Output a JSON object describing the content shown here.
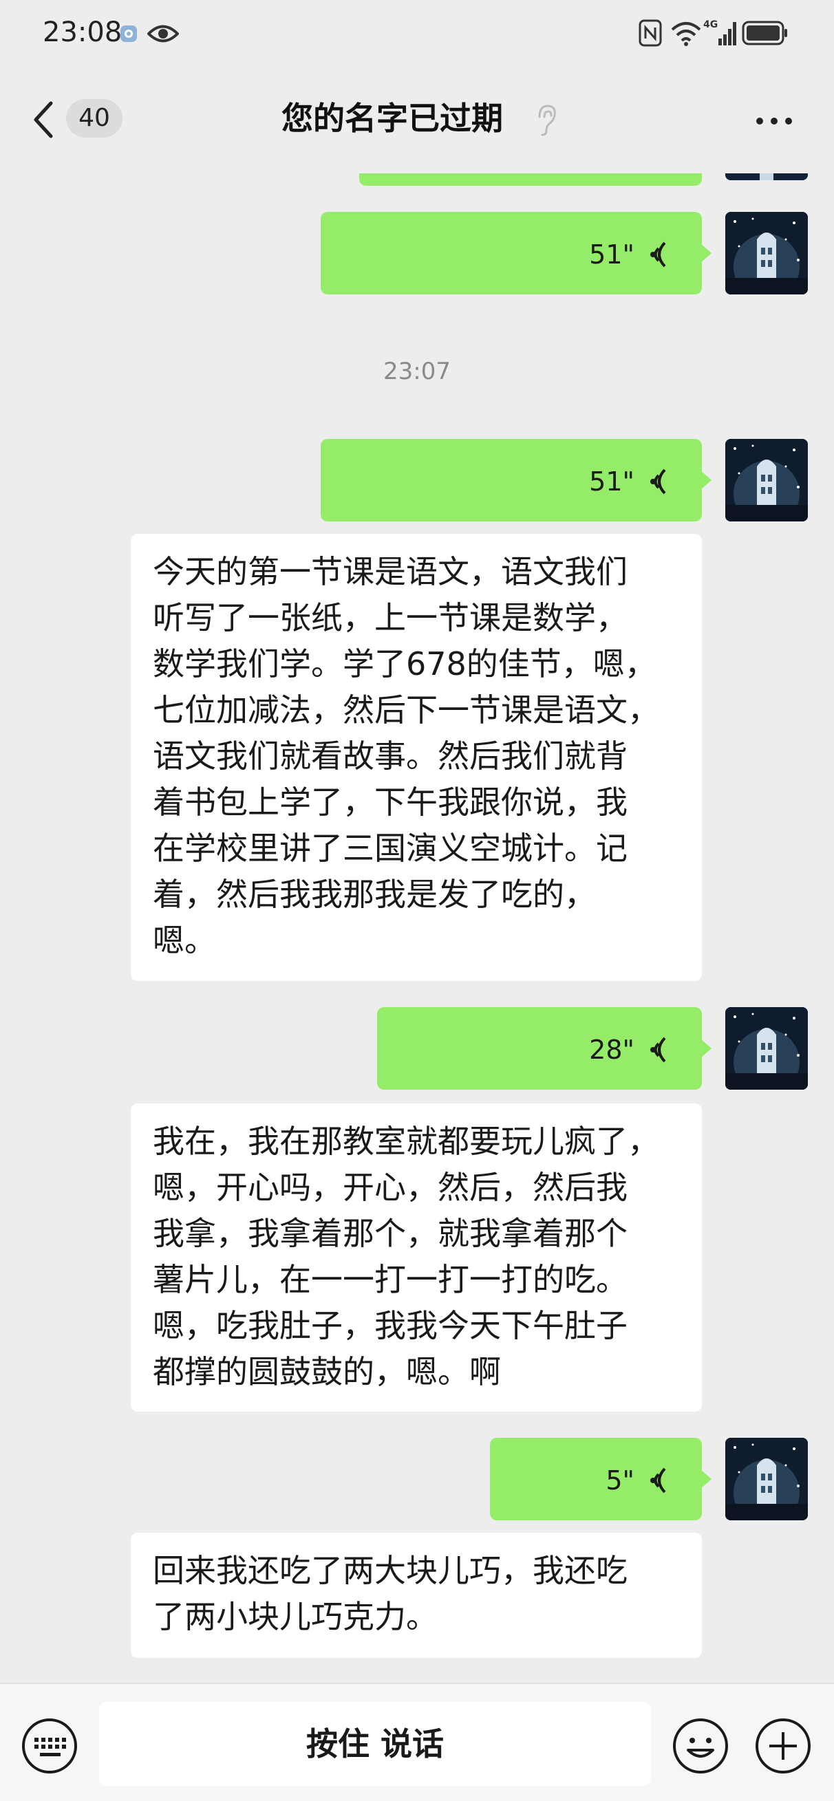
{
  "status_bar": {
    "time": "23:08",
    "network": "4G"
  },
  "header": {
    "unread_count": "40",
    "title": "您的名字已过期"
  },
  "messages": [
    {
      "type": "voice",
      "duration": "51\""
    },
    {
      "type": "timestamp",
      "text": "23:07"
    },
    {
      "type": "voice",
      "duration": "51\""
    },
    {
      "type": "transcript",
      "text": "今天的第一节课是语文，语文我们\n听写了一张纸，上一节课是数学，\n数学我们学。学了678的佳节，嗯，\n七位加减法，然后下一节课是语文，\n语文我们就看故事。然后我们就背\n着书包上学了，下午我跟你说，我\n在学校里讲了三国演义空城计。记\n着，然后我我那我是发了吃的，\n嗯。"
    },
    {
      "type": "voice",
      "duration": "28\""
    },
    {
      "type": "transcript",
      "text": "我在，我在那教室就都要玩儿疯了，\n嗯，开心吗，开心，然后，然后我\n我拿，我拿着那个，就我拿着那个\n薯片儿，在一一打一打一打的吃。\n嗯，吃我肚子，我我今天下午肚子\n都撑的圆鼓鼓的，嗯。啊"
    },
    {
      "type": "voice",
      "duration": "5\""
    },
    {
      "type": "transcript",
      "text": "回来我还吃了两大块儿巧，我还吃\n了两小块儿巧克力。"
    }
  ],
  "input_bar": {
    "hold_to_talk_label": "按住 说话"
  },
  "colors": {
    "bubble_green": "#95ec69",
    "background": "#ededed"
  }
}
